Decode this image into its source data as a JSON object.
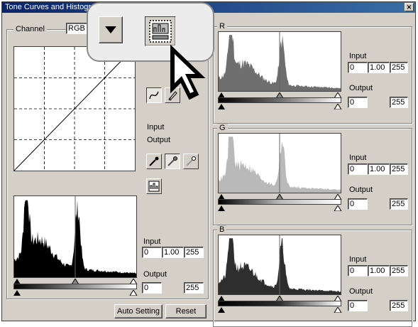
{
  "window": {
    "title": "Tone Curves and Histogr",
    "close_glyph": "×"
  },
  "channel": {
    "label": "Channel",
    "value": "RGB"
  },
  "curve_tools": {
    "input_label": "Input",
    "output_label": "Output"
  },
  "master": {
    "input_label": "Input",
    "input_black": "0",
    "input_gamma": "1.00",
    "input_white": "255",
    "output_label": "Output",
    "output_black": "0",
    "output_white": "255"
  },
  "buttons": {
    "auto_setting": "Auto Setting",
    "reset": "Reset"
  },
  "channels": [
    {
      "name": "R",
      "color": "#6e6e6e",
      "input_label": "Input",
      "input_black": "0",
      "input_gamma": "1.00",
      "input_white": "255",
      "output_label": "Output",
      "output_black": "0",
      "output_white": "255"
    },
    {
      "name": "G",
      "color": "#b9b9b9",
      "input_label": "Input",
      "input_black": "0",
      "input_gamma": "1.00",
      "input_white": "255",
      "output_label": "Output",
      "output_black": "0",
      "output_white": "255"
    },
    {
      "name": "B",
      "color": "#2e2e2e",
      "input_label": "Input",
      "input_black": "0",
      "input_gamma": "1.00",
      "input_white": "255",
      "output_label": "Output",
      "output_black": "0",
      "output_white": "255"
    }
  ],
  "icons": [
    "dropdown-arrow-icon",
    "histogram-window-icon",
    "pointer-cursor-icon",
    "curve-mode-icon",
    "pencil-icon",
    "black-point-eyedropper-icon",
    "gray-point-eyedropper-icon",
    "white-point-eyedropper-icon",
    "histogram-display-icon"
  ]
}
